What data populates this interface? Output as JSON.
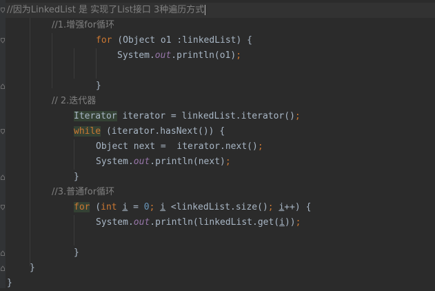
{
  "editor": {
    "lines": {
      "comment_header": "//因为LinkedList 是 实现了List接口 3种遍历方式",
      "comment1": "//1.增强for循环",
      "for1_kw": "for",
      "for1_rest": " (Object o1 :linkedList) {",
      "print1_a": "System.",
      "print1_out": "out",
      "print1_b": ".println(o1)",
      "print1_semi": ";",
      "close1": "}",
      "comment2": "// 2.迭代器",
      "iter_type": "Iterator",
      "iter_rest": " iterator = linkedList.iterator()",
      "iter_semi": ";",
      "while_kw": "while",
      "while_rest": " (iterator.hasNext()) {",
      "next_a": "Object next =  iterator.next()",
      "next_semi": ";",
      "print2_a": "System.",
      "print2_out": "out",
      "print2_b": ".println(next)",
      "print2_semi": ";",
      "close2": "}",
      "comment3": "//3.普通for循环",
      "for3_kw": "for",
      "for3_a": " (",
      "for3_int": "int",
      "for3_b": " ",
      "for3_i1": "i",
      "for3_c": " = ",
      "for3_zero": "0",
      "for3_semi1": ";",
      "for3_d": " ",
      "for3_i2": "i",
      "for3_e": " <linkedList.size()",
      "for3_semi2": ";",
      "for3_f": " ",
      "for3_i3": "i",
      "for3_g": "++) {",
      "print3_a": "System.",
      "print3_out": "out",
      "print3_b": ".println(linkedList.get(",
      "print3_i": "i",
      "print3_c": "))",
      "print3_semi": ";",
      "close3": "}",
      "close_method": "}",
      "close_class": "}"
    }
  }
}
